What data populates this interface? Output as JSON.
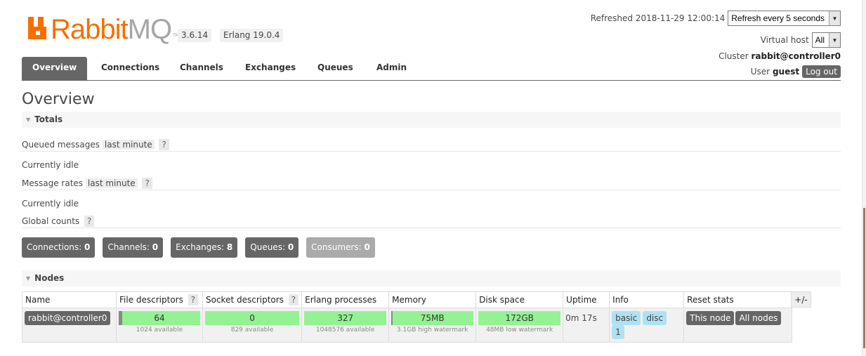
{
  "brand": {
    "name_primary": "Rabbit",
    "name_secondary": "MQ",
    "trademark": "TM"
  },
  "versions": {
    "rabbitmq": "3.6.14",
    "erlang": "Erlang 19.0.4"
  },
  "header": {
    "refreshed": "Refreshed 2018-11-29 12:00:14",
    "refresh_select": "Refresh every 5 seconds",
    "vhost_label": "Virtual host",
    "vhost_select": "All",
    "cluster_label": "Cluster",
    "cluster_value": "rabbit@controller0",
    "user_label": "User",
    "user_value": "guest",
    "logout": "Log out"
  },
  "nav": {
    "tabs": [
      "Overview",
      "Connections",
      "Channels",
      "Exchanges",
      "Queues",
      "Admin"
    ],
    "active": "Overview"
  },
  "page_title": "Overview",
  "totals": {
    "title": "Totals",
    "queued_label": "Queued messages",
    "queued_range": "last minute",
    "idle1": "Currently idle",
    "rates_label": "Message rates",
    "rates_range": "last minute",
    "idle2": "Currently idle",
    "global_label": "Global counts",
    "help": "?"
  },
  "counts": [
    {
      "label": "Connections:",
      "value": "0"
    },
    {
      "label": "Channels:",
      "value": "0"
    },
    {
      "label": "Exchanges:",
      "value": "8"
    },
    {
      "label": "Queues:",
      "value": "0"
    },
    {
      "label": "Consumers:",
      "value": "0"
    }
  ],
  "nodes": {
    "title": "Nodes",
    "plusminus": "+/-",
    "columns": [
      "Name",
      "File descriptors",
      "Socket descriptors",
      "Erlang processes",
      "Memory",
      "Disk space",
      "Uptime",
      "Info",
      "Reset stats"
    ],
    "row": {
      "name": "rabbit@controller0",
      "fd": "64",
      "fd_sub": "1024 available",
      "sockets": "0",
      "sockets_sub": "829 available",
      "procs": "327",
      "procs_sub": "1048576 available",
      "memory": "75MB",
      "memory_sub": "3.1GB high watermark",
      "disk": "172GB",
      "disk_sub": "48MB low watermark",
      "uptime": "0m 17s",
      "info_tags": [
        "basic",
        "disc",
        "1"
      ],
      "reset_buttons": [
        "This node",
        "All nodes"
      ]
    }
  },
  "colors": {
    "brand_orange": "#f66f00",
    "bar_green": "#94f194",
    "tag_blue": "#aee2f2",
    "dark_button": "#666666"
  }
}
